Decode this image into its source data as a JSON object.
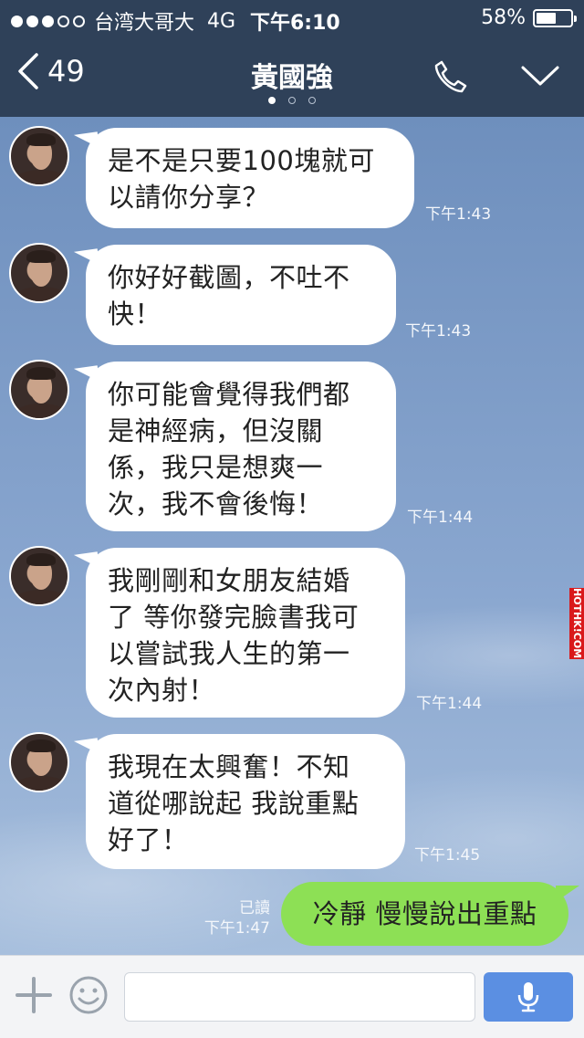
{
  "status_bar": {
    "carrier": "台湾大哥大",
    "network": "4G",
    "time": "下午6:10",
    "battery": "58%",
    "battery_level": 0.58,
    "signal_bars_filled": 3,
    "signal_bars_total": 5
  },
  "header": {
    "back_count": "49",
    "contact_name": "黃國強",
    "page_indicator": {
      "count": 3,
      "active": 1
    },
    "icons": [
      "back-chevron-icon",
      "phone-icon",
      "chevron-down-icon"
    ]
  },
  "messages": [
    {
      "text_lines": [
        "是不是只要100塊就可",
        "以請你分享？"
      ],
      "time": "下午1:43"
    },
    {
      "text_lines": [
        "你好好截圖，不吐不",
        "快！"
      ],
      "time": "下午1:43"
    },
    {
      "text_lines": [
        "你可能會覺得我們都",
        "是神經病，但沒關",
        "係，我只是想爽一",
        "次，我不會後悔！"
      ],
      "time": "下午1:44"
    },
    {
      "text_lines": [
        "我剛剛和女朋友結婚",
        "了 等你發完臉書我可",
        "以嘗試我人生的第一",
        "次內射！"
      ],
      "time": "下午1:44"
    },
    {
      "text_lines": [
        "我現在太興奮！不知",
        "道從哪說起 我說重點",
        "好了！"
      ],
      "time": "下午1:45"
    }
  ],
  "outgoing": {
    "text": "冷靜 慢慢說出重點",
    "read_label": "已讀",
    "time": "下午1:47"
  },
  "watermark": "HOTHK!COM",
  "input_bar": {
    "icons": [
      "plus-icon",
      "smiley-icon",
      "microphone-icon"
    ],
    "placeholder": ""
  },
  "colors": {
    "header_bg": "#2f4159",
    "outgoing_bubble": "#8de055",
    "mic_button": "#5b8fe2"
  }
}
